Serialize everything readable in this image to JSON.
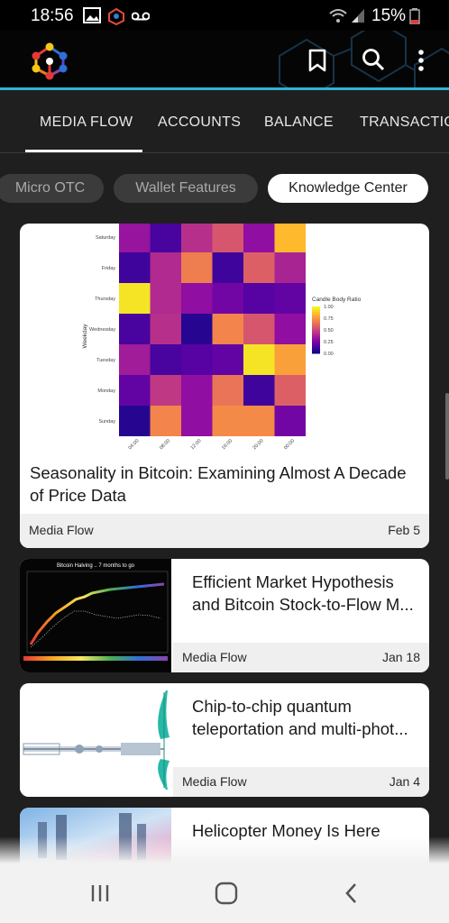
{
  "status_bar": {
    "time": "18:56",
    "battery": "15%"
  },
  "toolbar": {
    "bookmark_icon": "bookmark-icon",
    "search_icon": "search-icon",
    "more_icon": "more-vert-icon"
  },
  "tabs": [
    {
      "label": "MEDIA FLOW",
      "selected": true
    },
    {
      "label": "ACCOUNTS",
      "selected": false
    },
    {
      "label": "BALANCE",
      "selected": false
    },
    {
      "label": "TRANSACTIO",
      "selected": false
    }
  ],
  "chips": [
    {
      "label": "Micro OTC",
      "selected": false
    },
    {
      "label": "Wallet Features",
      "selected": false
    },
    {
      "label": "Knowledge Center",
      "selected": true
    }
  ],
  "featured_card": {
    "title": "Seasonality in Bitcoin: Examining Almost A Decade of Price Data",
    "source": "Media Flow",
    "date": "Feb 5",
    "heatmap": {
      "y_axis_label": "Weekday",
      "rows": [
        "Saturday",
        "Friday",
        "Thursday",
        "Wednesday",
        "Tuesday",
        "Monday",
        "Sunday"
      ],
      "cols": [
        "04:00",
        "08:00",
        "12:00",
        "16:00",
        "20:00",
        "00:00"
      ],
      "legend_title": "Candle Body Ratio",
      "legend_ticks": [
        "1.00",
        "0.75",
        "0.50",
        "0.25",
        "0.00"
      ],
      "values": [
        [
          0.32,
          0.12,
          0.42,
          0.55,
          0.3,
          0.85
        ],
        [
          0.1,
          0.4,
          0.68,
          0.1,
          0.58,
          0.38
        ],
        [
          0.95,
          0.4,
          0.3,
          0.22,
          0.15,
          0.18
        ],
        [
          0.12,
          0.42,
          0.05,
          0.7,
          0.55,
          0.3
        ],
        [
          0.35,
          0.12,
          0.15,
          0.18,
          0.95,
          0.78
        ],
        [
          0.18,
          0.45,
          0.3,
          0.65,
          0.1,
          0.58
        ],
        [
          0.05,
          0.7,
          0.3,
          0.72,
          0.72,
          0.22
        ]
      ]
    }
  },
  "articles": [
    {
      "title_line1": "Efficient Market Hypothesis",
      "title_line2": "and Bitcoin Stock-to-Flow M...",
      "source": "Media Flow",
      "date": "Jan 18",
      "thumb_caption": "Bitcoin Halving .. 7 months to go"
    },
    {
      "title_line1": "Chip-to-chip quantum",
      "title_line2": "teleportation and multi-phot...",
      "source": "Media Flow",
      "date": "Jan 4"
    },
    {
      "title_line1": "Helicopter Money Is Here"
    }
  ],
  "nav": {
    "recents_icon": "recents-icon",
    "home_icon": "home-icon",
    "back_icon": "back-icon"
  }
}
